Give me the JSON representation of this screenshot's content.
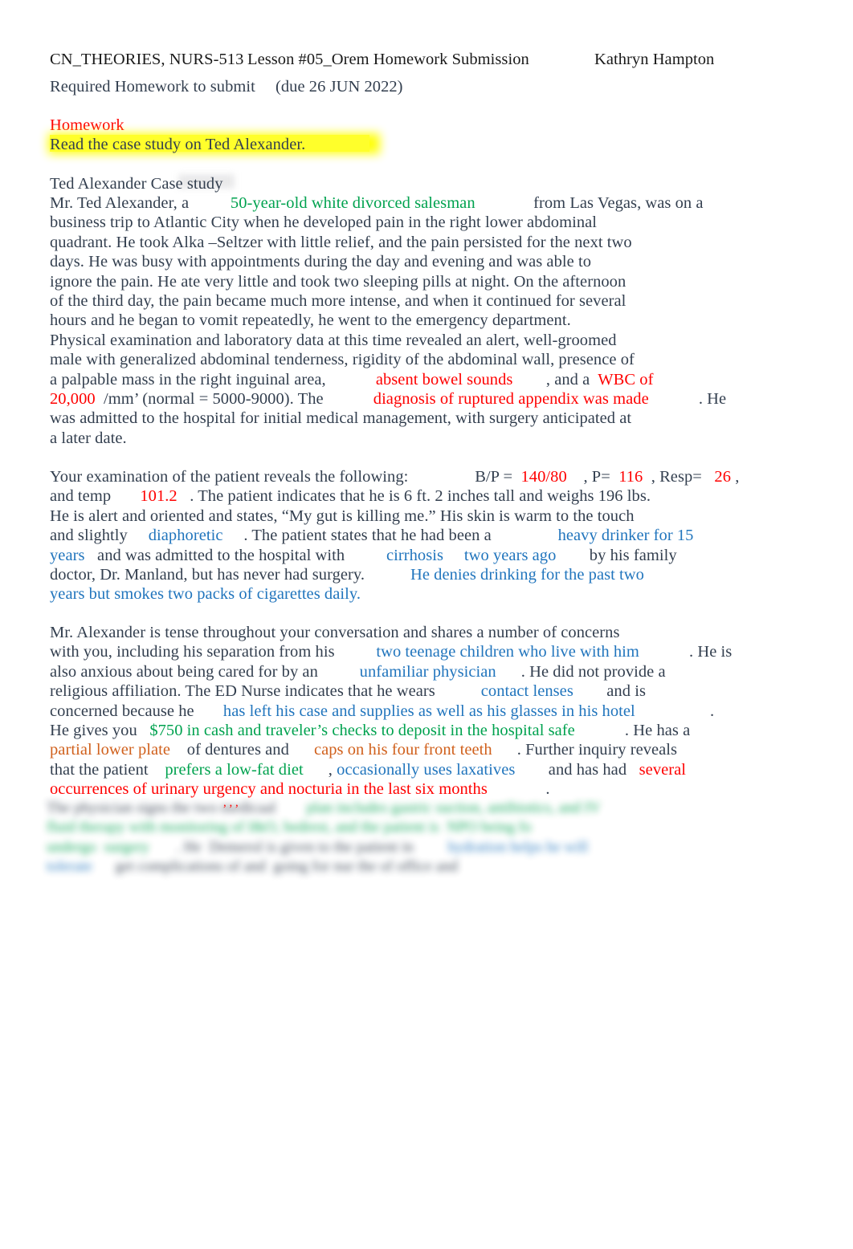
{
  "document": {
    "header": {
      "course": "CN_THEORIES, NURS-513",
      "lesson": "Lesson #05_Orem Homework Submission",
      "student": "Kathryn Hampton",
      "subtitle_left": "Required Homework to submit",
      "subtitle_due": "(due 26 JUN 2022)"
    },
    "homework": {
      "label": "Homework",
      "instruction": "Read the case study on Ted Alexander."
    },
    "case_study": {
      "title": "Ted Alexander Case study",
      "lines": [
        [
          {
            "t": "Mr. Ted Alexander, a          ",
            "c": "body"
          },
          {
            "t": "50-year-old white divorced salesman",
            "c": "green"
          },
          {
            "t": "              from Las Vegas, was on a",
            "c": "body"
          }
        ],
        [
          {
            "t": "business trip to Atlantic City when he developed pain in the right lower abdominal",
            "c": "body"
          }
        ],
        [
          {
            "t": "quadrant. He took Alka –Seltzer with little relief, and the pain persisted for the next two",
            "c": "body"
          }
        ],
        [
          {
            "t": "days. He was busy with appointments during the day and evening and was able to",
            "c": "body"
          }
        ],
        [
          {
            "t": "ignore the pain. He ate very little and took two sleeping pills at night. On the afternoon",
            "c": "body"
          }
        ],
        [
          {
            "t": "of the third day, the pain became much more intense, and when it continued for several",
            "c": "body"
          }
        ],
        [
          {
            "t": "hours and he began to vomit repeatedly, he went to the emergency department.",
            "c": "body"
          }
        ],
        [
          {
            "t": "Physical examination and laboratory data at this time revealed an alert, well-groomed",
            "c": "body"
          }
        ],
        [
          {
            "t": "male with generalized abdominal tenderness, rigidity of the abdominal wall, presence of",
            "c": "body"
          }
        ],
        [
          {
            "t": "a palpable mass in the right inguinal area,            ",
            "c": "body"
          },
          {
            "t": "absent bowel sounds",
            "c": "red"
          },
          {
            "t": "        , and a  ",
            "c": "body"
          },
          {
            "t": "WBC of",
            "c": "red"
          }
        ],
        [
          {
            "t": "20,000",
            "c": "red"
          },
          {
            "t": "  /mm’ (normal = 5000-9000). The            ",
            "c": "body"
          },
          {
            "t": "diagnosis of ruptured appendix was made",
            "c": "red"
          },
          {
            "t": "            . He",
            "c": "body"
          }
        ],
        [
          {
            "t": "was admitted to the hospital for initial medical management, with surgery anticipated at",
            "c": "body"
          }
        ],
        [
          {
            "t": "a later date.",
            "c": "body"
          }
        ]
      ]
    },
    "exam": {
      "lines": [
        [
          {
            "t": "Your examination of the patient reveals the following:                ",
            "c": "body"
          },
          {
            "t": "B/P = ",
            "c": "body"
          },
          {
            "t": " 140/80",
            "c": "red"
          },
          {
            "t": "    , P= ",
            "c": "body"
          },
          {
            "t": " 116",
            "c": "red"
          },
          {
            "t": "  , Resp= ",
            "c": "body"
          },
          {
            "t": "  26",
            "c": "red"
          },
          {
            "t": " ,",
            "c": "body"
          }
        ],
        [
          {
            "t": "and temp       ",
            "c": "body"
          },
          {
            "t": "101.2",
            "c": "red"
          },
          {
            "t": "   . The patient indicates that he is 6 ft. 2 inches tall and weighs 196 lbs.",
            "c": "body"
          }
        ],
        [
          {
            "t": "He is alert and oriented and states, “My gut is killing me.” His skin is warm to the touch",
            "c": "body"
          }
        ],
        [
          {
            "t": "and slightly     ",
            "c": "body"
          },
          {
            "t": "diaphoretic",
            "c": "blue"
          },
          {
            "t": "     . The patient states that he had been a                ",
            "c": "body"
          },
          {
            "t": "heavy drinker for 15",
            "c": "blue"
          }
        ],
        [
          {
            "t": "years",
            "c": "blue"
          },
          {
            "t": "   and was admitted to the hospital with          ",
            "c": "body"
          },
          {
            "t": "cirrhosis",
            "c": "blue"
          },
          {
            "t": "     ",
            "c": "body"
          },
          {
            "t": "two years ago",
            "c": "blue"
          },
          {
            "t": "        by his family",
            "c": "body"
          }
        ],
        [
          {
            "t": "doctor, Dr. Manland, but has never had surgery.           ",
            "c": "body"
          },
          {
            "t": "He denies drinking for the past two",
            "c": "blue"
          }
        ],
        [
          {
            "t": "years but smokes two packs of cigarettes daily.",
            "c": "blue"
          }
        ]
      ]
    },
    "concerns": {
      "lines": [
        [
          {
            "t": "Mr. Alexander is tense throughout your conversation and shares a number of concerns",
            "c": "body"
          }
        ],
        [
          {
            "t": "with you, including his separation from his          ",
            "c": "body"
          },
          {
            "t": "two teenage children who live with him",
            "c": "blue"
          },
          {
            "t": "            . He is",
            "c": "body"
          }
        ],
        [
          {
            "t": "also anxious about being cared for by an          ",
            "c": "body"
          },
          {
            "t": "unfamiliar physician",
            "c": "blue"
          },
          {
            "t": "      . He did not provide a",
            "c": "body"
          }
        ],
        [
          {
            "t": "religious affiliation. The ED Nurse indicates that he wears           ",
            "c": "body"
          },
          {
            "t": "contact lenses",
            "c": "blue"
          },
          {
            "t": "        and is",
            "c": "body"
          }
        ],
        [
          {
            "t": "concerned because he       ",
            "c": "body"
          },
          {
            "t": "has left his case and supplies as well as his glasses in his hotel",
            "c": "blue"
          },
          {
            "t": "                  .",
            "c": "body"
          }
        ],
        [
          {
            "t": "He gives you   ",
            "c": "body"
          },
          {
            "t": "$750 in cash and traveler’s checks to deposit in the hospital safe",
            "c": "green"
          },
          {
            "t": "            . He has a",
            "c": "body"
          }
        ],
        [
          {
            "t": "partial lower plate",
            "c": "orange"
          },
          {
            "t": "    of dentures and      ",
            "c": "body"
          },
          {
            "t": "caps on his four front teeth",
            "c": "orange"
          },
          {
            "t": "      . Further inquiry reveals",
            "c": "body"
          }
        ],
        [
          {
            "t": "that the patient    ",
            "c": "body"
          },
          {
            "t": "prefers a low-fat diet",
            "c": "green"
          },
          {
            "t": "      , ",
            "c": "body"
          },
          {
            "t": "occasionally uses laxatives",
            "c": "blue"
          },
          {
            "t": "        and has had   ",
            "c": "body"
          },
          {
            "t": "several",
            "c": "red"
          }
        ],
        [
          {
            "t": "occurrences of urinary urgency and nocturia in the last six months",
            "c": "red"
          },
          {
            "t": "              .",
            "c": "body"
          }
        ]
      ]
    },
    "obscured": {
      "note": "blurred-illegible-text",
      "lines": [
        [
          {
            "t": "The physician signs the two medicaal        ",
            "c": "body"
          },
          {
            "t": "plan includes gastric suction, antibiotics, and IV",
            "c": "green"
          }
        ],
        [
          {
            "t": "fluid therapy with monitoring of I&O, bedrest, and the patient is  ",
            "c": "green"
          },
          {
            "t": "NPO being fo",
            "c": "green"
          }
        ],
        [
          {
            "t": "undergo",
            "c": "green"
          },
          {
            "t": "  surgery",
            "c": "green"
          },
          {
            "t": "       . He  Demerol is given to the patient in ",
            "c": "body"
          },
          {
            "t": "        ",
            "c": "body"
          },
          {
            "t": "hydration helps he will",
            "c": "blue"
          }
        ],
        [
          {
            "t": "tolerate",
            "c": "blue"
          },
          {
            "t": "      get complications of and  going for nur the of office and",
            "c": "body"
          }
        ]
      ]
    }
  }
}
